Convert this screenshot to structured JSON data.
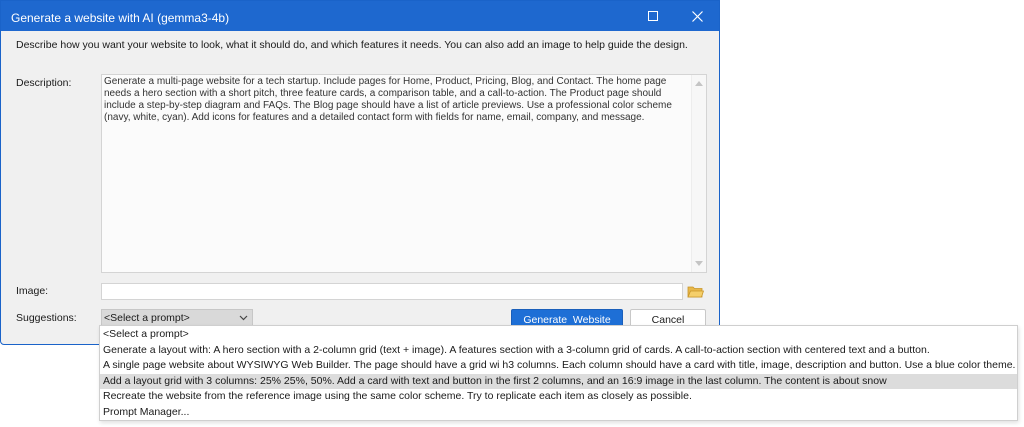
{
  "window": {
    "title": "Generate a website with AI (gemma3-4b)",
    "maximize_icon": "maximize-icon",
    "close_icon": "close-icon",
    "accent_color": "#1e68cf"
  },
  "form": {
    "intro": "Describe how you want your website to look, what it should do, and which features it needs. You can also add an image to help guide the design.",
    "description_label": "Description:",
    "description_value": "Generate a multi-page website for a tech startup. Include pages for Home, Product, Pricing, Blog, and Contact. The home page needs a hero section with a short pitch, three feature cards, a comparison table, and a call-to-action. The Product page should include a step-by-step diagram and FAQs. The Blog page should have a list of article previews. Use a professional color scheme (navy, white, cyan). Add icons for features and a detailed contact form with fields for name, email, company, and message.",
    "image_label": "Image:",
    "image_value": "",
    "folder_icon": "folder-icon",
    "suggestions_label": "Suggestions:",
    "suggestions_selected": "<Select a prompt>",
    "generate_label": "Generate  Website",
    "cancel_label": "Cancel"
  },
  "dropdown": {
    "options": [
      "<Select a prompt>",
      "Generate a layout with: A hero section with a 2-column grid (text + image). A features section with a 3-column grid of cards. A call-to-action section with centered text and a button.",
      "A single page website about WYSIWYG Web Builder. The page should have a grid wi  h3 columns. Each column should have a card with title, image, description and button. Use a blue color theme.",
      "Add a layout grid with 3 columns: 25% 25%, 50%. Add a card with text and button in the first 2 columns, and an 16:9 image in the last column. The content is about snow",
      "Recreate the website from the reference image using the same color scheme. Try to replicate each item as closely as possible.",
      "Prompt Manager..."
    ],
    "highlighted_index": 3
  }
}
